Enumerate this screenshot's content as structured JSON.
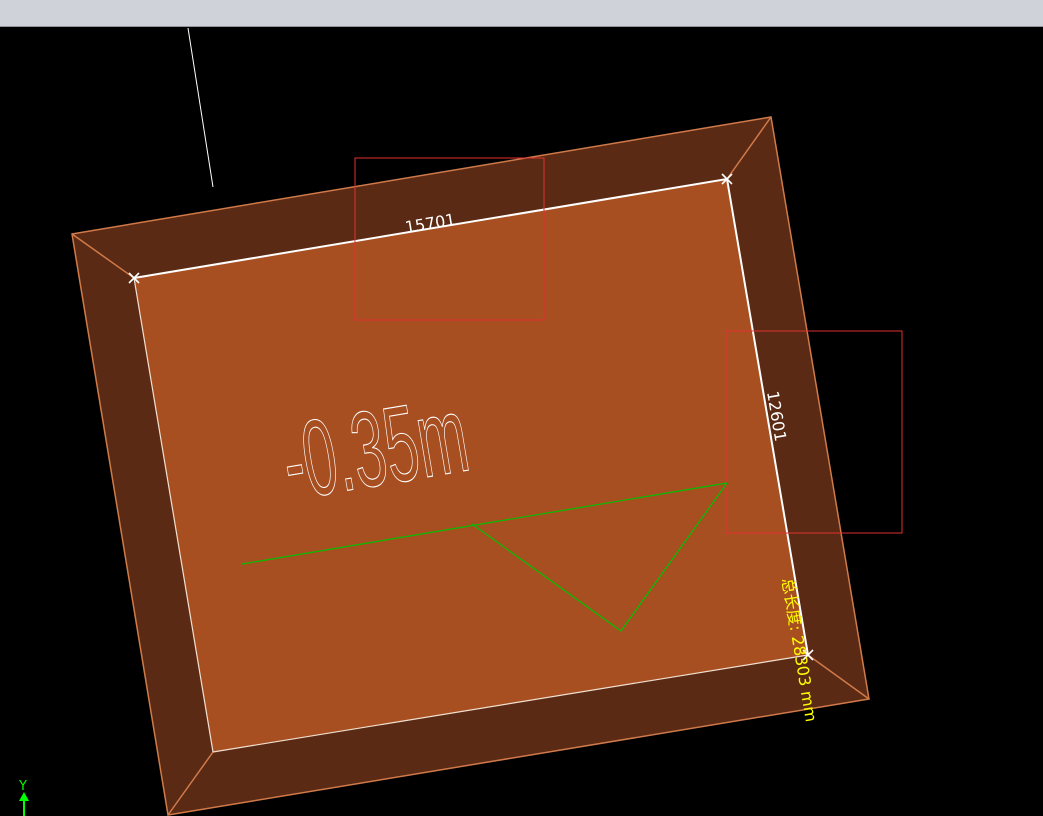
{
  "toolbar": {},
  "drawing": {
    "dimension_top": "15701",
    "dimension_right": "12601",
    "elevation_label": "-0.35m",
    "total_length_label": "总长度: 28303 mm",
    "axis_label": "Y"
  },
  "colors": {
    "background": "#000000",
    "toolbar": "#cfd2d9",
    "slab_inner": "#a84f22",
    "slab_border": "#5b2a14",
    "edge_outline": "#d07a4a",
    "selection_line": "#ffffff",
    "selection_box": "#e03030",
    "section_symbol": "#00c000",
    "total_length_text": "#ffff00",
    "axis": "#00ff00"
  }
}
